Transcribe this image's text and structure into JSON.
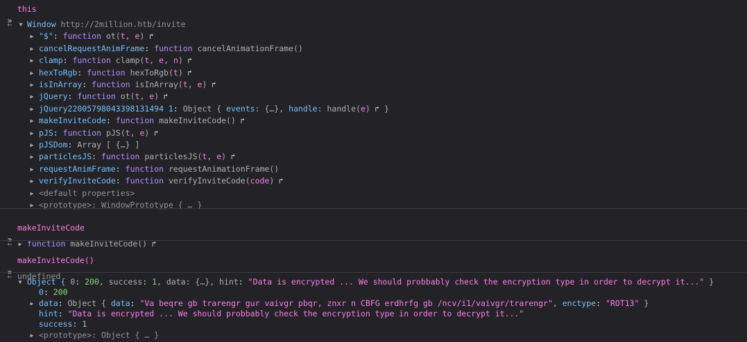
{
  "entries": [
    {
      "input": "this",
      "output_rows": [
        [
          {
            "t": "Window",
            "c": "key"
          },
          {
            "t": " "
          },
          {
            "t": "http://2million.htb/invite",
            "c": "muted"
          }
        ],
        [
          {
            "t": "\"$\"",
            "c": "key"
          },
          {
            "t": ": "
          },
          {
            "t": "function",
            "c": "fn"
          },
          {
            "t": " ot(",
            "c": "def"
          },
          {
            "t": "t",
            "c": "param"
          },
          {
            "t": ", ",
            "c": "def"
          },
          {
            "t": "e",
            "c": "param"
          },
          {
            "t": ")",
            "c": "def"
          },
          {
            "t": " ↱",
            "c": "jump"
          }
        ],
        [
          {
            "t": "cancelRequestAnimFrame",
            "c": "key"
          },
          {
            "t": ": "
          },
          {
            "t": "function",
            "c": "fn"
          },
          {
            "t": " cancelAnimationFrame()",
            "c": "def"
          }
        ],
        [
          {
            "t": "clamp",
            "c": "key"
          },
          {
            "t": ": "
          },
          {
            "t": "function",
            "c": "fn"
          },
          {
            "t": " clamp(",
            "c": "def"
          },
          {
            "t": "t",
            "c": "param"
          },
          {
            "t": ", ",
            "c": "def"
          },
          {
            "t": "e",
            "c": "param"
          },
          {
            "t": ", ",
            "c": "def"
          },
          {
            "t": "n",
            "c": "param"
          },
          {
            "t": ")",
            "c": "def"
          },
          {
            "t": " ↱",
            "c": "jump"
          }
        ],
        [
          {
            "t": "hexToRgb",
            "c": "key"
          },
          {
            "t": ": "
          },
          {
            "t": "function",
            "c": "fn"
          },
          {
            "t": " hexToRgb(",
            "c": "def"
          },
          {
            "t": "t",
            "c": "param"
          },
          {
            "t": ")",
            "c": "def"
          },
          {
            "t": " ↱",
            "c": "jump"
          }
        ],
        [
          {
            "t": "isInArray",
            "c": "key"
          },
          {
            "t": ": "
          },
          {
            "t": "function",
            "c": "fn"
          },
          {
            "t": " isInArray(",
            "c": "def"
          },
          {
            "t": "t",
            "c": "param"
          },
          {
            "t": ", ",
            "c": "def"
          },
          {
            "t": "e",
            "c": "param"
          },
          {
            "t": ")",
            "c": "def"
          },
          {
            "t": " ↱",
            "c": "jump"
          }
        ],
        [
          {
            "t": "jQuery",
            "c": "key"
          },
          {
            "t": ": "
          },
          {
            "t": "function",
            "c": "fn"
          },
          {
            "t": " ot(",
            "c": "def"
          },
          {
            "t": "t",
            "c": "param"
          },
          {
            "t": ", ",
            "c": "def"
          },
          {
            "t": "e",
            "c": "param"
          },
          {
            "t": ")",
            "c": "def"
          },
          {
            "t": " ↱",
            "c": "jump"
          }
        ],
        [
          {
            "t": "jQuery22005798043398131494 1",
            "c": "key"
          },
          {
            "t": ": "
          },
          {
            "t": "Object { ",
            "c": "def"
          },
          {
            "t": "events",
            "c": "key"
          },
          {
            "t": ": {…}, ",
            "c": "def"
          },
          {
            "t": "handle",
            "c": "key"
          },
          {
            "t": ": ",
            "c": "def"
          },
          {
            "t": "handle(",
            "c": "def"
          },
          {
            "t": "e",
            "c": "param"
          },
          {
            "t": ")",
            "c": "def"
          },
          {
            "t": " ↱",
            "c": "jump"
          },
          {
            "t": " }",
            "c": "def"
          }
        ],
        [
          {
            "t": "makeInviteCode",
            "c": "key"
          },
          {
            "t": ": "
          },
          {
            "t": "function",
            "c": "fn"
          },
          {
            "t": " makeInviteCode()",
            "c": "def"
          },
          {
            "t": " ↱",
            "c": "jump"
          }
        ],
        [
          {
            "t": "pJS",
            "c": "key"
          },
          {
            "t": ": "
          },
          {
            "t": "function",
            "c": "fn"
          },
          {
            "t": " pJS(",
            "c": "def"
          },
          {
            "t": "t",
            "c": "param"
          },
          {
            "t": ", ",
            "c": "def"
          },
          {
            "t": "e",
            "c": "param"
          },
          {
            "t": ")",
            "c": "def"
          },
          {
            "t": " ↱",
            "c": "jump"
          }
        ],
        [
          {
            "t": "pJSDom",
            "c": "key"
          },
          {
            "t": ": "
          },
          {
            "t": "Array [ {…} ]",
            "c": "def"
          }
        ],
        [
          {
            "t": "particlesJS",
            "c": "key"
          },
          {
            "t": ": "
          },
          {
            "t": "function",
            "c": "fn"
          },
          {
            "t": " particlesJS(",
            "c": "def"
          },
          {
            "t": "t",
            "c": "param"
          },
          {
            "t": ", ",
            "c": "def"
          },
          {
            "t": "e",
            "c": "param"
          },
          {
            "t": ")",
            "c": "def"
          },
          {
            "t": " ↱",
            "c": "jump"
          }
        ],
        [
          {
            "t": "requestAnimFrame",
            "c": "key"
          },
          {
            "t": ": "
          },
          {
            "t": "function",
            "c": "fn"
          },
          {
            "t": " requestAnimationFrame()",
            "c": "def"
          }
        ],
        [
          {
            "t": "verifyInviteCode",
            "c": "key"
          },
          {
            "t": ": "
          },
          {
            "t": "function",
            "c": "fn"
          },
          {
            "t": " verifyInviteCode(",
            "c": "def"
          },
          {
            "t": "code",
            "c": "param"
          },
          {
            "t": ")",
            "c": "def"
          },
          {
            "t": " ↱",
            "c": "jump"
          }
        ],
        [
          {
            "t": "<default properties>",
            "c": "muted"
          }
        ],
        [
          {
            "t": "<prototype>",
            "c": "muted"
          },
          {
            "t": ": WindowPrototype { … }",
            "c": "muted"
          }
        ]
      ]
    },
    {
      "input": "makeInviteCode",
      "output_rows": [
        [
          {
            "t": "function",
            "c": "fn"
          },
          {
            "t": " makeInviteCode()",
            "c": "def"
          },
          {
            "t": " ↱",
            "c": "jump"
          }
        ]
      ]
    },
    {
      "input": "makeInviteCode()",
      "output_rows": [
        [
          {
            "t": "undefined",
            "c": "muted"
          }
        ]
      ],
      "logged_rows": [
        [
          {
            "t": "Object { ",
            "c": "key"
          },
          {
            "t": "0",
            "c": "def"
          },
          {
            "t": ": "
          },
          {
            "t": "200",
            "c": "num"
          },
          {
            "t": ", ",
            "c": "def"
          },
          {
            "t": "success",
            "c": "def"
          },
          {
            "t": ": "
          },
          {
            "t": "1",
            "c": "num"
          },
          {
            "t": ", ",
            "c": "def"
          },
          {
            "t": "data",
            "c": "def"
          },
          {
            "t": ": {…}, ",
            "c": "def"
          },
          {
            "t": "hint",
            "c": "def"
          },
          {
            "t": ": "
          },
          {
            "t": "\"Data is encrypted ... We should probbably check the encryption type in order to decrypt it...\"",
            "c": "str"
          },
          {
            "t": " }",
            "c": "def"
          }
        ],
        [
          {
            "t": "0",
            "c": "key"
          },
          {
            "t": ": "
          },
          {
            "t": "200",
            "c": "num"
          }
        ],
        [
          {
            "t": "data",
            "c": "key"
          },
          {
            "t": ": "
          },
          {
            "t": "Object { ",
            "c": "def"
          },
          {
            "t": "data",
            "c": "key"
          },
          {
            "t": ": "
          },
          {
            "t": "\"Va beqre gb trarengr gur vaivgr pbqr, znxr n CBFG erdhrfg gb /ncv/i1/vaivgr/trarengr\"",
            "c": "str"
          },
          {
            "t": ", ",
            "c": "def"
          },
          {
            "t": "enctype",
            "c": "key"
          },
          {
            "t": ": "
          },
          {
            "t": "\"ROT13\"",
            "c": "str"
          },
          {
            "t": " }",
            "c": "def"
          }
        ],
        [
          {
            "t": "hint",
            "c": "key"
          },
          {
            "t": ": "
          },
          {
            "t": "\"Data is encrypted ... We should probbably check the encryption type in order to decrypt it...\"",
            "c": "str"
          }
        ],
        [
          {
            "t": "success",
            "c": "key"
          },
          {
            "t": ": "
          },
          {
            "t": "1",
            "c": "num"
          }
        ],
        [
          {
            "t": "<prototype>",
            "c": "muted"
          },
          {
            "t": ": Object { … }",
            "c": "muted"
          }
        ]
      ]
    }
  ]
}
